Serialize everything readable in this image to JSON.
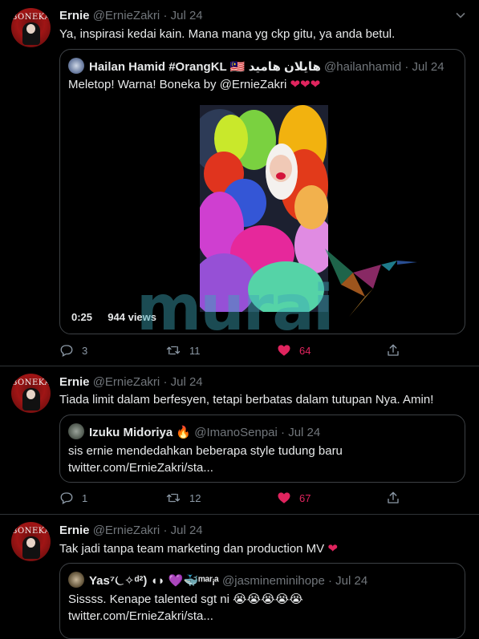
{
  "tweets": [
    {
      "author": "Ernie",
      "handle": "@ErnieZakri",
      "dot": "·",
      "date": "Jul 24",
      "avatar_text": "BONEKA",
      "text": "Ya, inspirasi kedai kain. Mana mana yg ckp gitu, ya anda betul.",
      "quote": {
        "author": "Hailan Hamid #OrangKL",
        "flag": "🇲🇾",
        "author_arabic": "هايلان هاميد",
        "handle": "@hailanhamid",
        "date": "Jul 24",
        "text": "Meletop! Warna! Boneka by @ErnieZakri",
        "hearts": "❤❤❤",
        "video_time": "0:25",
        "video_views": "944 views"
      },
      "actions": {
        "replies": "3",
        "retweets": "11",
        "likes": "64"
      }
    },
    {
      "author": "Ernie",
      "handle": "@ErnieZakri",
      "dot": "·",
      "date": "Jul 24",
      "avatar_text": "BONEKA",
      "text": "Tiada limit dalam berfesyen, tetapi berbatas dalam tutupan Nya. Amin!",
      "quote": {
        "author": "Izuku Midoriya",
        "emoji": "🔥",
        "handle": "@ImanoSenpai",
        "date": "Jul 24",
        "line1": "sis ernie mendedahkan beberapa style tudung baru",
        "line2": "twitter.com/ErnieZakri/sta..."
      },
      "actions": {
        "replies": "1",
        "retweets": "12",
        "likes": "67"
      }
    },
    {
      "author": "Ernie",
      "handle": "@ErnieZakri",
      "dot": "·",
      "date": "Jul 24",
      "avatar_text": "BONEKA",
      "text": "Tak jadi tanpa team marketing dan production MV",
      "heart": "❤",
      "quote": {
        "author": "Yas⁷⏾✧ᵈ²) ◖◗ 💜🐳ᵐᵃʳᵢᵃ",
        "handle": "@jasmineminihope",
        "date": "Jul 24",
        "line1": "Sissss. Kenape talented sgt ni",
        "emojis": "😭😭😭😭😭",
        "line2": "twitter.com/ErnieZakri/sta..."
      }
    }
  ],
  "watermark": "murai",
  "colors": {
    "like_active": "#e0245e",
    "muted": "#71767b",
    "border": "#3d4145"
  }
}
